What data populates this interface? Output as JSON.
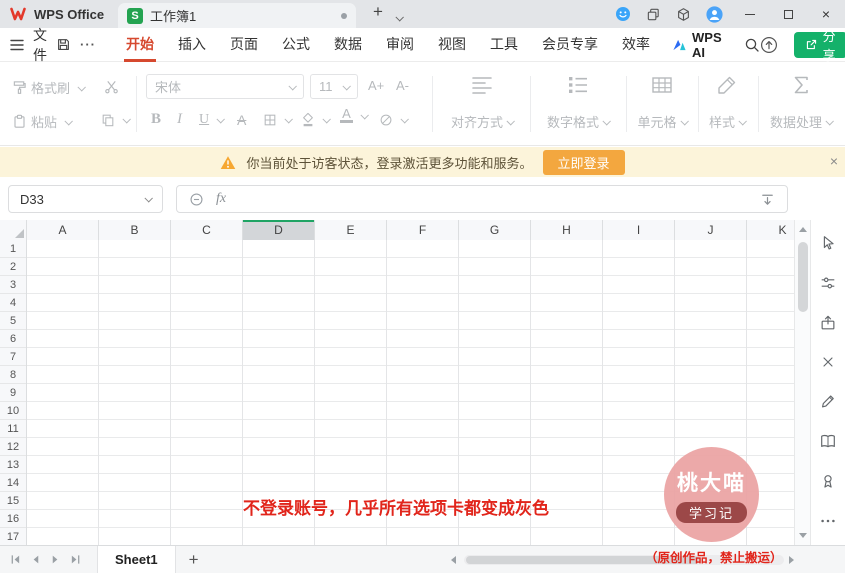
{
  "titlebar": {
    "app_name": "WPS Office",
    "doc_icon_letter": "S",
    "doc_title": "工作簿1",
    "new_tab": "+",
    "close": "×"
  },
  "menubar": {
    "file": "文件",
    "more": "···",
    "tabs": [
      "开始",
      "插入",
      "页面",
      "公式",
      "数据",
      "审阅",
      "视图",
      "工具",
      "会员专享",
      "效率"
    ],
    "active_tab": "开始",
    "ai": "WPS AI",
    "share": "分享"
  },
  "ribbon": {
    "format_painter": "格式刷",
    "paste": "粘贴",
    "font_name": "宋体",
    "font_size": "11",
    "grow_font": "A+",
    "shrink_font": "A-",
    "bold": "B",
    "italic": "I",
    "underline": "U",
    "strike_letter": "A",
    "color_letter": "A",
    "groups": [
      "对齐方式",
      "数字格式",
      "单元格",
      "样式",
      "数据处理"
    ]
  },
  "notice": {
    "message": "你当前处于访客状态，登录激活更多功能和服务。",
    "login": "立即登录",
    "close": "×"
  },
  "formula": {
    "name_box": "D33",
    "fx": "fx"
  },
  "grid": {
    "columns": [
      "A",
      "B",
      "C",
      "D",
      "E",
      "F",
      "G",
      "H",
      "I",
      "J",
      "K"
    ],
    "selected_column": "D",
    "rows": [
      "1",
      "2",
      "3",
      "4",
      "5",
      "6",
      "7",
      "8",
      "9",
      "10",
      "11",
      "12",
      "13",
      "14",
      "15",
      "16",
      "17"
    ]
  },
  "sheetbar": {
    "sheet": "Sheet1",
    "add": "+"
  },
  "overlay": {
    "caption": "不登录账号，几乎所有选项卡都变成灰色",
    "stamp_title": "桃大喵",
    "stamp_sub": "学习记",
    "copyright": "（原创作品，禁止搬运）"
  },
  "colors": {
    "accent_green": "#1fa464",
    "brand_red": "#e3392b",
    "active_tab_red": "#d6492f",
    "share_green": "#14b16a",
    "notice_bg": "#fcf4da",
    "login_orange": "#f3a73f",
    "overlay_red": "#e1251b",
    "stamp_pink": "#eba6a6",
    "stamp_badge": "#9c4848"
  }
}
